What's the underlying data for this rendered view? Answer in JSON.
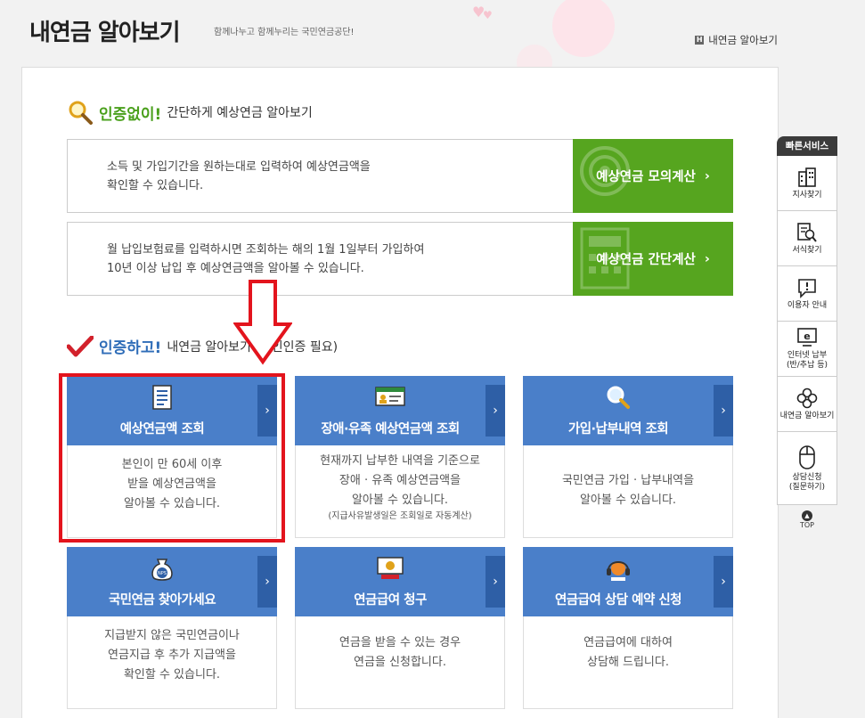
{
  "page": {
    "title": "내연금 알아보기",
    "subtitle": "함께나누고 함께누리는 국민연금공단!",
    "breadcrumb": "내연금 알아보기",
    "breadcrumb_icon": "home-icon"
  },
  "section_calc": {
    "strong": "인증없이!",
    "rest": "간단하게 예상연금 알아보기",
    "icon": "magnifier-icon",
    "rows": [
      {
        "desc_line1": "소득 및 가입기간을 원하는대로 입력하여 예상연금액을",
        "desc_line2": "확인할 수 있습니다.",
        "button": "예상연금 모의계산"
      },
      {
        "desc_line1": "월 납입보험료를 입력하시면 조회하는 해의 1월 1일부터 가입하여",
        "desc_line2": "10년 이상 납입 후 예상연금액을 알아볼 수 있습니다.",
        "button": "예상연금 간단계산"
      }
    ]
  },
  "section_auth": {
    "strong": "인증하고!",
    "rest": "내연금 알아보기 (공인인증 필요)",
    "icon": "checkmark-icon"
  },
  "cards": [
    {
      "title": "예상연금액 조회",
      "icon": "document-icon",
      "lines": [
        "본인이 만 60세 이후",
        "받을 예상연금액을",
        "알아볼 수 있습니다."
      ],
      "note": ""
    },
    {
      "title": "장애·유족 예상연금액 조회",
      "icon": "id-card-icon",
      "lines": [
        "현재까지 납부한 내역을 기준으로",
        "장애 · 유족 예상연금액을",
        "알아볼 수 있습니다."
      ],
      "note": "(지급사유발생일은 조회일로 자동계산)"
    },
    {
      "title": "가입·납부내역 조회",
      "icon": "search-icon",
      "lines": [
        "국민연금 가입 · 납부내역을",
        "알아볼 수 있습니다."
      ],
      "note": ""
    },
    {
      "title": "국민연금 찾아가세요",
      "icon": "nps-pouch-icon",
      "lines": [
        "지급받지 않은 국민연금이나",
        "연금지급 후 추가 지급액을",
        "확인할 수 있습니다."
      ],
      "note": ""
    },
    {
      "title": "연금급여 청구",
      "icon": "monitor-icon",
      "lines": [
        "연금을 받을 수 있는 경우",
        "연금을 신청합니다."
      ],
      "note": ""
    },
    {
      "title": "연금급여 상담 예약 신청",
      "icon": "headset-icon",
      "lines": [
        "연금급여에 대하여",
        "상담해 드립니다."
      ],
      "note": ""
    }
  ],
  "quick_service": {
    "title": "빠른서비스",
    "items": [
      {
        "label": "지사찾기",
        "label2": "",
        "icon": "building-icon"
      },
      {
        "label": "서식찾기",
        "label2": "",
        "icon": "form-search-icon"
      },
      {
        "label": "이용자 안내",
        "label2": "",
        "icon": "notice-icon"
      },
      {
        "label": "인터넷 납부",
        "label2": "(반/추납 등)",
        "icon": "internet-pay-icon"
      },
      {
        "label": "내연금 알아보기",
        "label2": "",
        "icon": "clover-icon"
      },
      {
        "label": "상담신청",
        "label2": "(질문하기)",
        "icon": "mouse-icon"
      }
    ],
    "top": "TOP"
  },
  "colors": {
    "green": "#56a51f",
    "blue": "#4a7fc9",
    "blue_dark": "#2e5fa6",
    "highlight_red": "#e3141d"
  }
}
